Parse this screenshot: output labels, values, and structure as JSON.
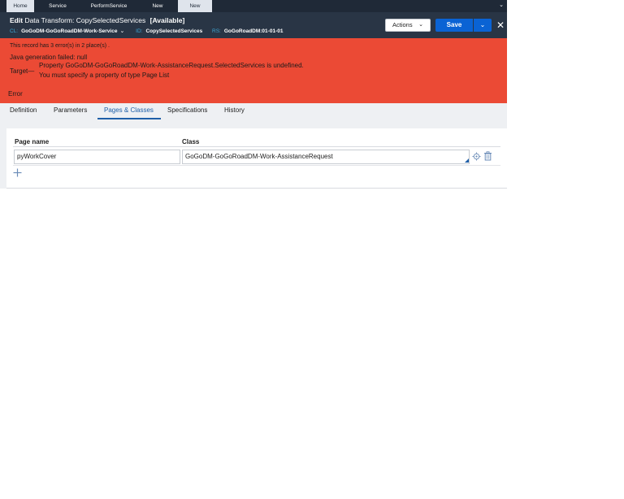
{
  "tabs": [
    {
      "label": "Home",
      "active": true
    },
    {
      "label": "Service",
      "active": false
    },
    {
      "label": "PerformService",
      "active": false
    },
    {
      "label": "New",
      "active": false
    },
    {
      "label": "New",
      "active": true
    }
  ],
  "header": {
    "edit_prefix": "Edit",
    "title": "Data Transform: CopySelectedServices",
    "status": "[Available]",
    "cl_label": "CL:",
    "cl_value": "GoGoDM-GoGoRoadDM-Work-Service",
    "id_label": "ID:",
    "id_value": "CopySelectedServices",
    "rs_label": "RS:",
    "rs_value": "GoGoRoadDM:01-01-01",
    "actions_label": "Actions",
    "save_label": "Save"
  },
  "errors": {
    "summary": "This record has 3 error(s) in 2 place(s) .",
    "java": "Java generation failed: null",
    "target_label": "Target—",
    "property_msg": "Property GoGoDM-GoGoRoadDM-Work-AssistanceRequest.SelectedServices is undefined.",
    "must_msg": "You must specify a property of type Page List",
    "error_label": "Error"
  },
  "subtabs": [
    {
      "label": "Definition",
      "active": false
    },
    {
      "label": "Parameters",
      "active": false
    },
    {
      "label": "Pages & Classes",
      "active": true
    },
    {
      "label": "Specifications",
      "active": false
    },
    {
      "label": "History",
      "active": false
    }
  ],
  "table": {
    "headers": [
      "Page name",
      "Class"
    ],
    "rows": [
      {
        "page": "pyWorkCover",
        "class": "GoGoDM-GoGoRoadDM-Work-AssistanceRequest"
      }
    ]
  },
  "colors": {
    "error_bg": "#eb4a35",
    "header_bg": "#293545",
    "accent": "#0a63d4",
    "tab_active": "#1f5fa8"
  },
  "icons": [
    "chevron-down-icon",
    "close-icon",
    "target-icon",
    "trash-icon",
    "plus-icon"
  ]
}
